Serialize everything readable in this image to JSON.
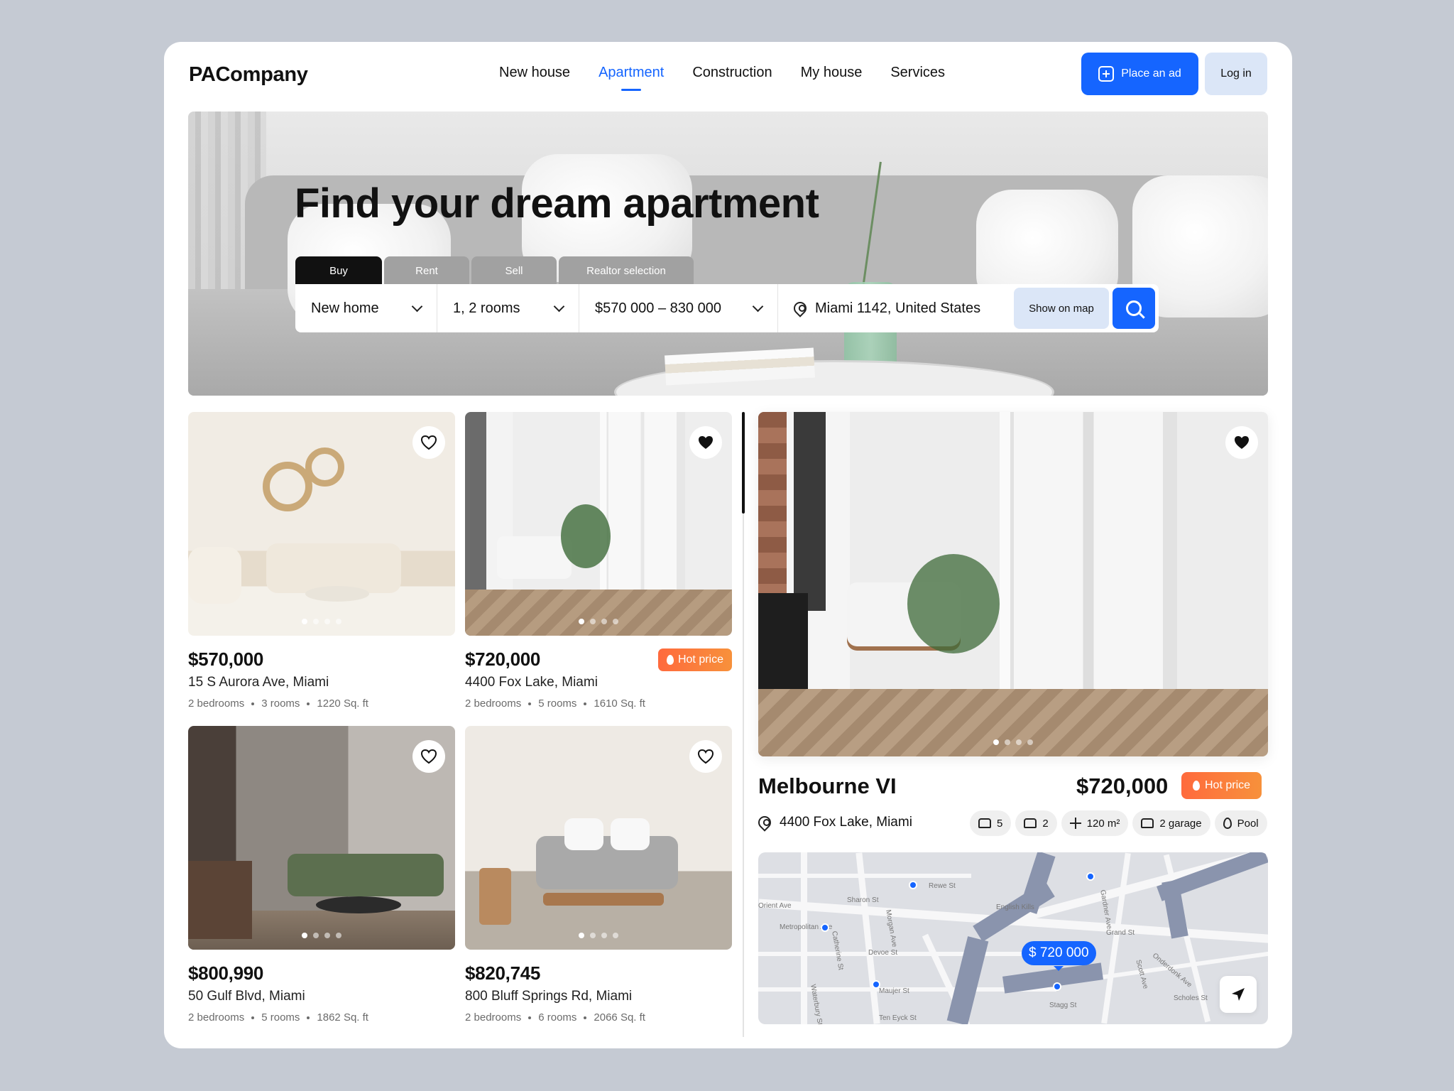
{
  "header": {
    "logo": "PACompany",
    "nav": [
      "New house",
      "Apartment",
      "Construction",
      "My house",
      "Services"
    ],
    "active_nav": "Apartment",
    "place_ad_label": "Place an ad",
    "login_label": "Log in"
  },
  "hero": {
    "title": "Find your dream apartment",
    "tabs": [
      "Buy",
      "Rent",
      "Sell",
      "Realtor selection"
    ],
    "active_tab": "Buy",
    "search": {
      "type": "New home",
      "rooms": "1, 2 rooms",
      "price": "$570 000 – 830 000",
      "location": "Miami 1142, United States",
      "show_on_map_label": "Show on map"
    }
  },
  "listings": [
    {
      "price": "$570,000",
      "address": "15 S Aurora Ave, Miami",
      "bedrooms": "2 bedrooms",
      "rooms": "3 rooms",
      "area": "1220 Sq. ft",
      "favorite": false,
      "hot": false
    },
    {
      "price": "$720,000",
      "address": "4400 Fox Lake, Miami",
      "bedrooms": "2 bedrooms",
      "rooms": "5 rooms",
      "area": "1610 Sq. ft",
      "favorite": true,
      "hot": true,
      "hot_label": "Hot price"
    },
    {
      "price": "$800,990",
      "address": "50 Gulf Blvd, Miami",
      "bedrooms": "2 bedrooms",
      "rooms": "5 rooms",
      "area": "1862 Sq. ft",
      "favorite": false,
      "hot": false
    },
    {
      "price": "$820,745",
      "address": "800 Bluff Springs Rd, Miami",
      "bedrooms": "2 bedrooms",
      "rooms": "6 rooms",
      "area": "2066 Sq. ft",
      "favorite": false,
      "hot": false
    }
  ],
  "detail": {
    "name": "Melbourne VI",
    "price": "$720,000",
    "hot_label": "Hot price",
    "address": "4400 Fox Lake, Miami",
    "features": [
      "5",
      "2",
      "120 m²",
      "2 garage",
      "Pool"
    ],
    "favorite": true
  },
  "map": {
    "price_pin": "$ 720 000",
    "streets": [
      "Metropolitan Ave",
      "Grand St",
      "Sharon St",
      "Devoe St",
      "Maujer St",
      "Ten Eyck St",
      "Stagg St",
      "Scholes St",
      "Morgan Ave",
      "Catherine St",
      "English Kills",
      "Orient Ave",
      "Waterbury St",
      "Onderdonk Ave",
      "Scott Ave",
      "Rewe St",
      "Gardner Ave"
    ]
  },
  "colors": {
    "accent": "#1565ff",
    "hot": "#ff6a3d",
    "login_bg": "#dbe6f7"
  }
}
